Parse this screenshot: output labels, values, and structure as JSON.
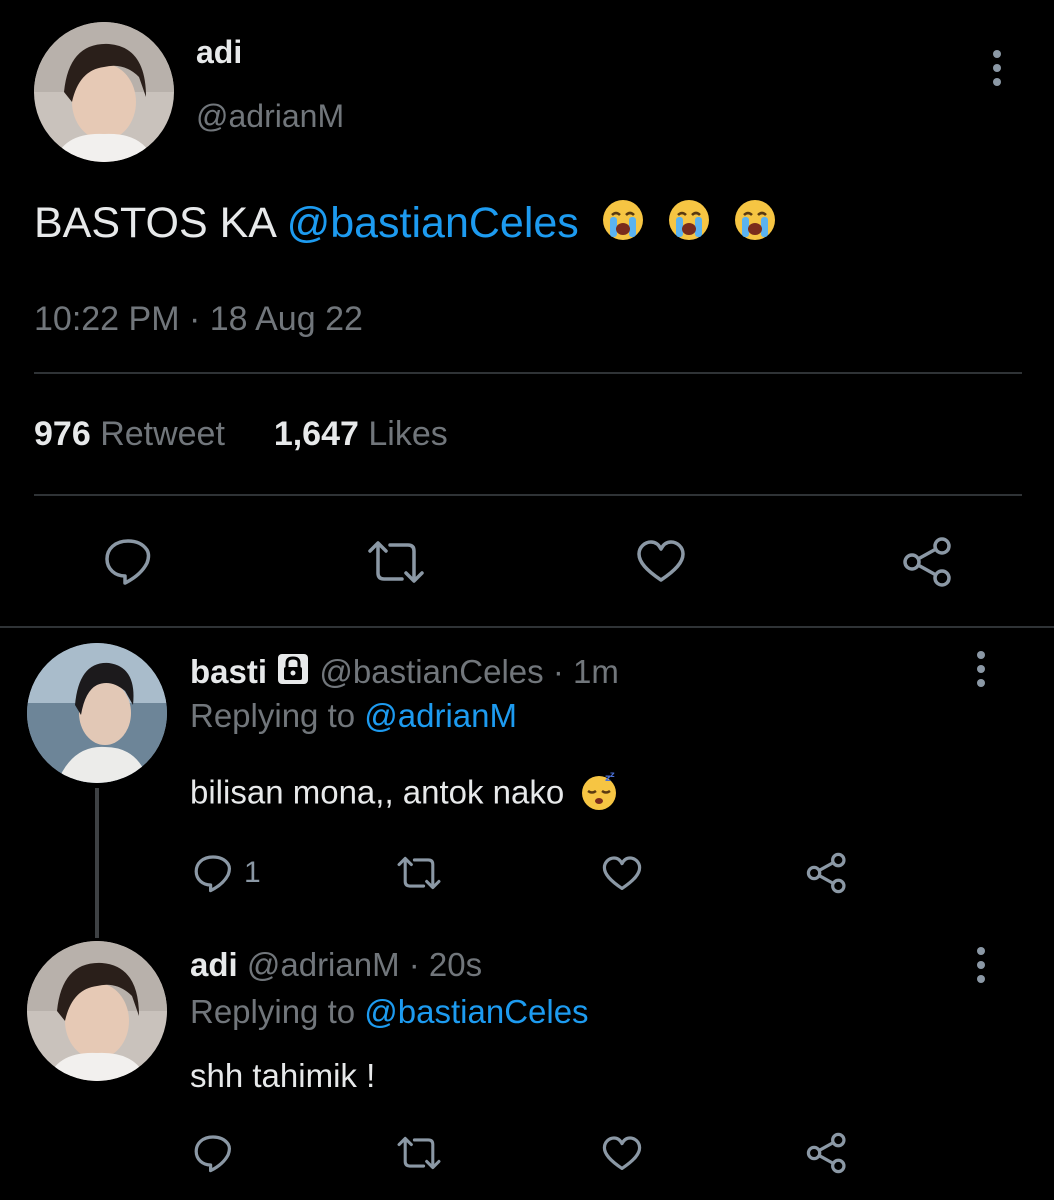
{
  "main_tweet": {
    "name": "adi",
    "handle": "@adrianM",
    "text": "BASTOS KA",
    "mention": "@bastianCeles",
    "timestamp": "10:22 PM · 18 Aug 22",
    "retweet_count": "976",
    "retweet_label": "Retweet",
    "like_count": "1,647",
    "like_label": "Likes"
  },
  "replies": [
    {
      "name": "basti",
      "handle": "@bastianCeles",
      "time": "· 1m",
      "replying_label": "Replying to",
      "replying_to": "@adrianM",
      "text": "bilisan mona,, antok nako",
      "reply_count": "1",
      "protected": true
    },
    {
      "name": "adi",
      "handle": "@adrianM",
      "time": "· 20s",
      "replying_label": "Replying to",
      "replying_to": "@bastianCeles",
      "text": "shh tahimik !"
    }
  ],
  "icons": {
    "more": "more-vertical-icon",
    "reply": "comment-icon",
    "retweet": "retweet-icon",
    "like": "heart-icon",
    "share": "share-icon",
    "lock": "lock-icon",
    "crying": "loudly-crying-face-emoji",
    "sleeping": "sleeping-face-emoji"
  },
  "colors": {
    "background": "#000000",
    "text": "#e7e9ea",
    "muted": "#71767b",
    "link": "#1d9bf0",
    "divider": "#2f3336"
  }
}
